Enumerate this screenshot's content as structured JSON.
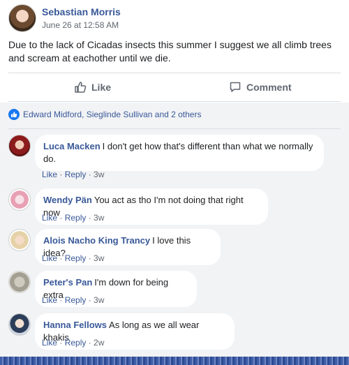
{
  "post": {
    "author": "Sebastian Morris",
    "timestamp": "June 26 at 12:58 AM",
    "text": "Due to the lack of Cicadas insects this summer I suggest we all climb trees and scream at eachother until we die."
  },
  "actions": {
    "like_label": "Like",
    "comment_label": "Comment"
  },
  "reactions": {
    "summary": "Edward Midford, Sieglinde Sullivan and 2 others"
  },
  "comments": [
    {
      "name": "Luca Macken",
      "text": "I don't get how that's different than what we normally do.",
      "like": "Like",
      "reply": "Reply",
      "time": "3w"
    },
    {
      "name": "Wendy Pän",
      "text": "You act as tho I'm not doing that right now",
      "like": "Like",
      "reply": "Reply",
      "time": "3w"
    },
    {
      "name": "Alois Nacho King Trancy",
      "text": "I love this idea?",
      "like": "Like",
      "reply": "Reply",
      "time": "3w"
    },
    {
      "name": "Peter's Pan",
      "text": "I'm down for being extra",
      "like": "Like",
      "reply": "Reply",
      "time": "3w"
    },
    {
      "name": "Hanna Fellows",
      "text": "As long as we all wear khakis",
      "like": "Like",
      "reply": "Reply",
      "time": "2w"
    }
  ],
  "colors": {
    "link": "#385898",
    "meta": "#616770",
    "feedback_bg": "#f2f3f5",
    "like_badge": "#1877f2"
  },
  "icons": {
    "like": "thumbs-up-icon",
    "comment": "comment-bubble-icon",
    "reaction": "like-reaction-icon"
  }
}
